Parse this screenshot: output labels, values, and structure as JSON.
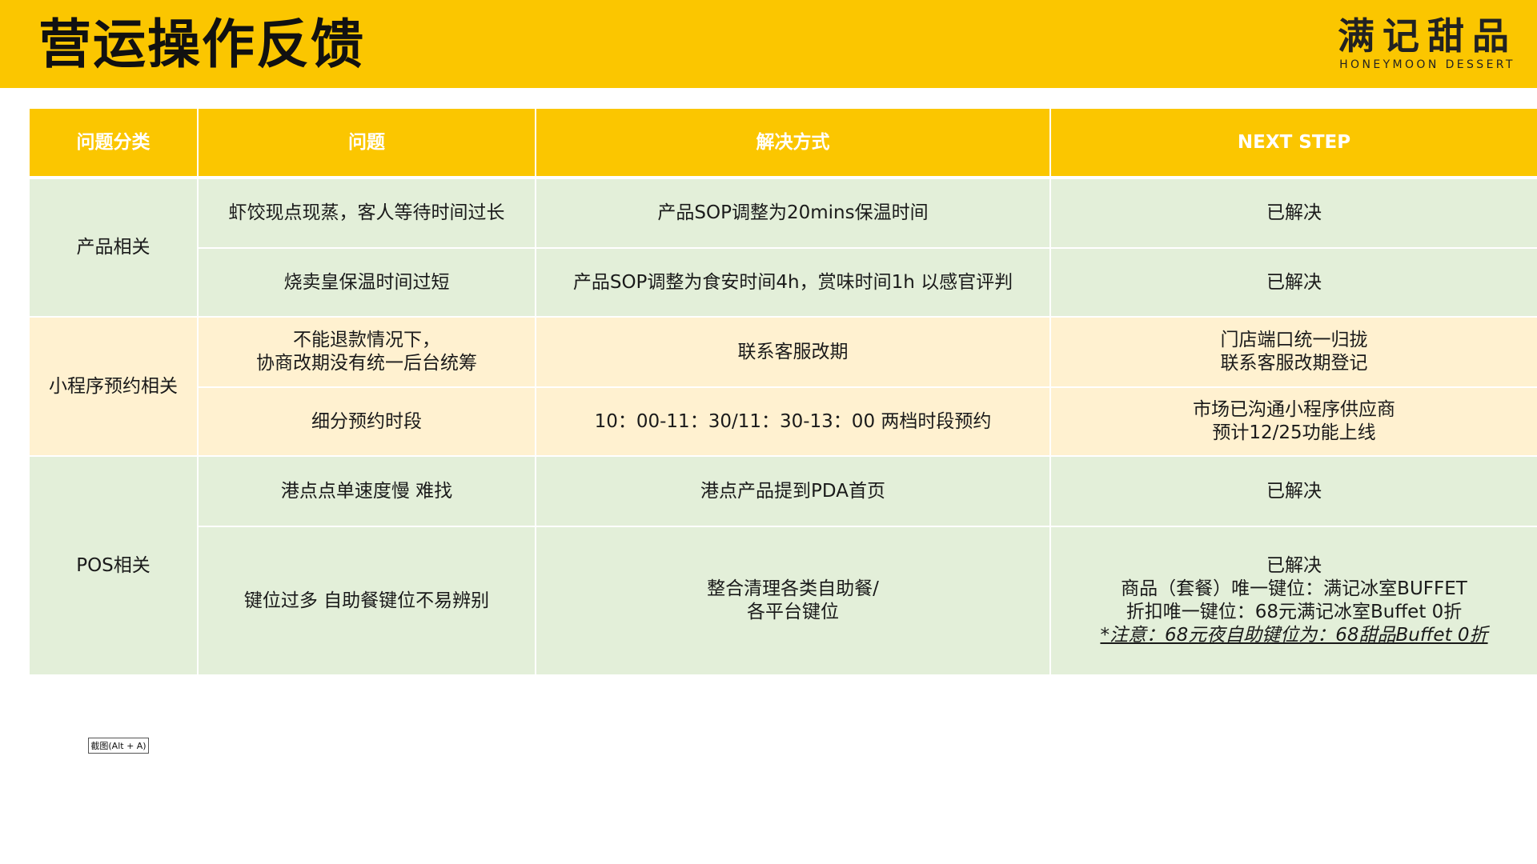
{
  "header": {
    "title": "营运操作反馈",
    "brand_cn": "满记甜品",
    "brand_en": "HONEYMOON DESSERT"
  },
  "table": {
    "headers": [
      "问题分类",
      "问题",
      "解决方式",
      "NEXT STEP"
    ],
    "groups": [
      {
        "category": "产品相关",
        "rows": [
          {
            "issue": [
              "虾饺现点现蒸，客人等待时间过长"
            ],
            "solution": [
              "产品SOP调整为20mins保温时间"
            ],
            "next": [
              "已解决"
            ]
          },
          {
            "issue": [
              "烧卖皇保温时间过短"
            ],
            "solution": [
              "产品SOP调整为食安时间4h，赏味时间1h 以感官评判"
            ],
            "next": [
              "已解决"
            ]
          }
        ]
      },
      {
        "category": "小程序预约相关",
        "rows": [
          {
            "issue": [
              "不能退款情况下，",
              "协商改期没有统一后台统筹"
            ],
            "solution": [
              "联系客服改期"
            ],
            "next": [
              "门店端口统一归拢",
              "联系客服改期登记"
            ]
          },
          {
            "issue": [
              "细分预约时段"
            ],
            "solution": [
              "10：00-11：30/11：30-13：00 两档时段预约"
            ],
            "next": [
              "市场已沟通小程序供应商",
              "预计12/25功能上线"
            ]
          }
        ]
      },
      {
        "category": "POS相关",
        "rows": [
          {
            "issue": [
              "港点点单速度慢 难找"
            ],
            "solution": [
              "港点产品提到PDA首页"
            ],
            "next": [
              "已解决"
            ]
          },
          {
            "issue": [
              "键位过多 自助餐键位不易辨别"
            ],
            "solution": [
              "整合清理各类自助餐/",
              "各平台键位"
            ],
            "next": [
              "已解决",
              "商品（套餐）唯一键位：满记冰室BUFFET",
              "折扣唯一键位：68元满记冰室Buffet 0折"
            ],
            "note": "*注意：68元夜自助键位为：68甜品Buffet 0折"
          }
        ]
      }
    ]
  },
  "screenshot_button": "截图(Alt + A)",
  "colors": {
    "accent": "#fbc600",
    "green_row": "#e3efd9",
    "yellow_row": "#fff1d0"
  }
}
